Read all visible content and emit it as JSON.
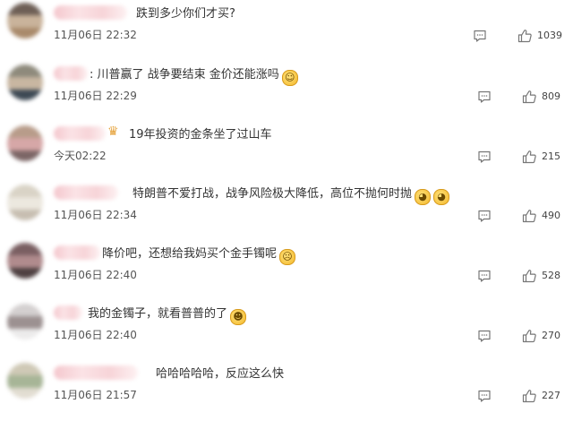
{
  "comments": [
    {
      "text": "跌到多少你们才买?",
      "time": "11月06日 22:32",
      "likes": "1039",
      "verified": false,
      "emojis": [],
      "avatar_colors": [
        "#6e5f56",
        "#c9b39b",
        "#a98a6b"
      ]
    },
    {
      "text": ": 川普赢了 战争要结束 金价还能涨吗",
      "time": "11月06日 22:29",
      "likes": "809",
      "verified": false,
      "emojis": [
        "face-icon"
      ],
      "avatar_colors": [
        "#8e8a7c",
        "#c8b6a1",
        "#3e4a55"
      ]
    },
    {
      "text": "19年投资的金条坐了过山车",
      "time": "今天02:22",
      "likes": "215",
      "verified": true,
      "emojis": [],
      "avatar_colors": [
        "#b89c8a",
        "#d6a7a7",
        "#7c6666"
      ]
    },
    {
      "text": "特朗普不爱打战，战争风险极大降低，高位不抛何时抛",
      "time": "11月06日 22:34",
      "likes": "490",
      "verified": false,
      "emojis": [
        "dog-face-icon",
        "dog-face-icon"
      ],
      "avatar_colors": [
        "#d9d3c6",
        "#ece8df",
        "#c7beb1"
      ]
    },
    {
      "text": "降价吧，还想给我妈买个金手镯呢",
      "time": "11月06日 22:40",
      "likes": "528",
      "verified": false,
      "emojis": [
        "crying-face-icon"
      ],
      "avatar_colors": [
        "#7a5f62",
        "#b08b8d",
        "#4f4142"
      ]
    },
    {
      "text": "我的金镯子，就看普普的了",
      "time": "11月06日 22:40",
      "likes": "270",
      "verified": false,
      "emojis": [
        "laughing-face-icon"
      ],
      "avatar_colors": [
        "#d4d0d0",
        "#9c9191",
        "#ecebeb"
      ]
    },
    {
      "text": "哈哈哈哈哈，反应这么快",
      "time": "11月06日 21:57",
      "likes": "227",
      "verified": false,
      "emojis": [],
      "avatar_colors": [
        "#cfc9b6",
        "#a7b597",
        "#e2ddd2"
      ]
    }
  ]
}
